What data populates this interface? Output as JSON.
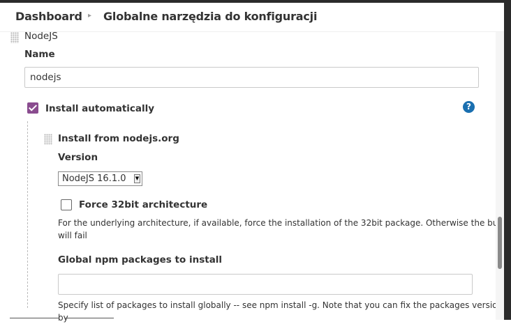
{
  "breadcrumb": {
    "item1": "Dashboard",
    "separator": "▸",
    "item2": "Globalne narzędzia do konfiguracji"
  },
  "section": {
    "title": "NodeJS",
    "name_label": "Name",
    "name_value": "nodejs",
    "install_auto_label": "Install automatically",
    "install_auto_checked": true,
    "help_icon": "?"
  },
  "installer": {
    "title": "Install from nodejs.org",
    "version_label": "Version",
    "version_value": "NodeJS 16.1.0",
    "force32_label": "Force 32bit architecture",
    "force32_checked": false,
    "force32_desc_line1": "For the underlying architecture, if available, force the installation of the 32bit package. Otherwise the build",
    "force32_desc_line2": "will fail",
    "npm_label": "Global npm packages to install",
    "npm_value": "",
    "npm_desc": "Specify list of packages to install globally -- see npm install -g. Note that you can fix the packages version by"
  },
  "colors": {
    "accent": "#8a4c8f",
    "help": "#1a6fb0"
  }
}
